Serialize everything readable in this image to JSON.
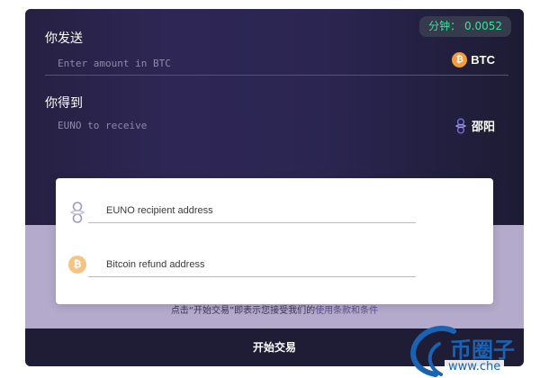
{
  "rate": {
    "label": "分钟",
    "value": "0.0052"
  },
  "send": {
    "label": "你发送",
    "placeholder": "Enter amount in BTC",
    "currency": "BTC",
    "coin_icon": "bitcoin-icon",
    "coin_color": "#f19d3b"
  },
  "receive": {
    "label": "你得到",
    "placeholder": "EUNO to receive",
    "currency": "邵阳",
    "coin_icon": "euno-icon"
  },
  "addresses": {
    "recipient_placeholder": "EUNO recipient address",
    "refund_placeholder": "Bitcoin refund address"
  },
  "terms": {
    "prefix": "点击“开始交易”即表示您接受我们的",
    "link": "使用条款和条件"
  },
  "trade_button": "开始交易",
  "watermark": {
    "text": "币圈子",
    "sub": "www.che"
  },
  "colors": {
    "panel_dark": "#2b2551",
    "panel_light": "#b4aacb",
    "rate_value": "#3ee39a",
    "button_bg": "#1f1c36",
    "bitcoin": "#f19d3b"
  }
}
